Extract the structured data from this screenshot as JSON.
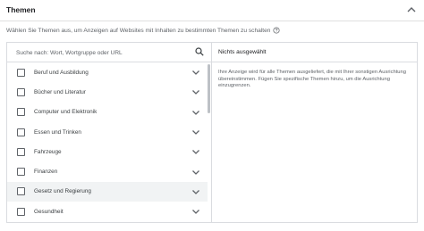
{
  "section": {
    "title": "Themen",
    "collapse_icon": "chevron-up-icon",
    "description": "Wählen Sie Themen aus, um Anzeigen auf Websites mit Inhalten zu bestimmten Themen zu schalten",
    "help_icon": "help-circle-icon"
  },
  "search": {
    "placeholder": "Suche nach: Wort, Wortgruppe oder URL",
    "value": "",
    "icon": "search-icon"
  },
  "topics": [
    {
      "label": "Beruf und Ausbildung"
    },
    {
      "label": "Bücher und Literatur"
    },
    {
      "label": "Computer und Elektronik"
    },
    {
      "label": "Essen und Trinken"
    },
    {
      "label": "Fahrzeuge"
    },
    {
      "label": "Finanzen"
    },
    {
      "label": "Gesetz und Regierung"
    },
    {
      "label": "Gesundheit"
    }
  ],
  "selected": {
    "title": "Nichts ausgewählt",
    "text": "Ihre Anzeige wird für alle Themen ausgeliefert, die mit Ihrer sonstigen Ausrichtung übereinstimmen. Fügen Sie spezifische Themen hinzu, um die Ausrichtung einzugrenzen."
  },
  "colors": {
    "border": "#dadce0",
    "text": "#3c4043",
    "muted": "#5f6368",
    "hover_row": "#f1f3f4"
  }
}
